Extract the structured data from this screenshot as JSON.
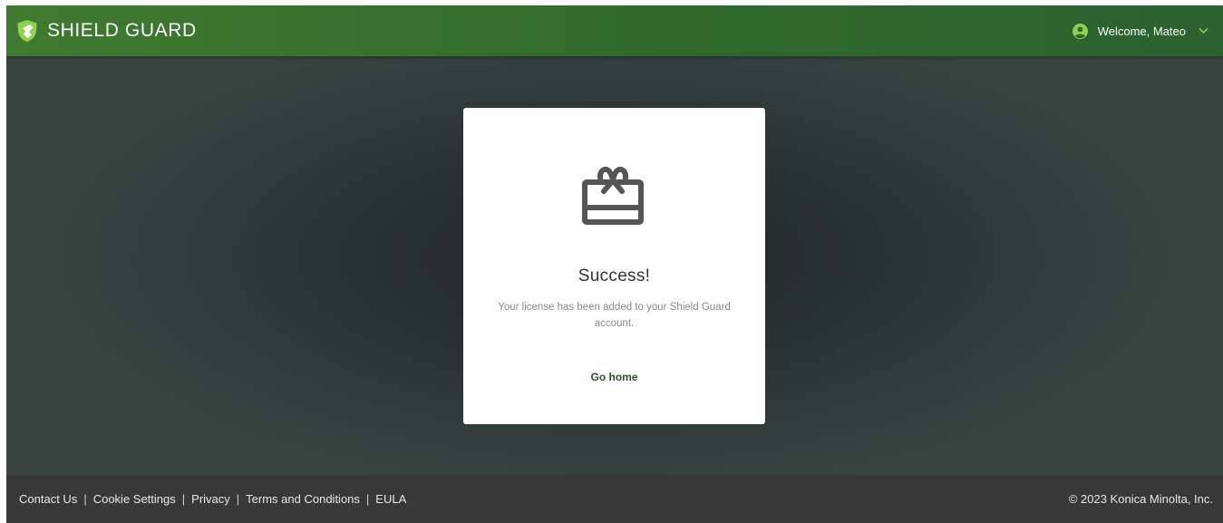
{
  "header": {
    "brand_name": "SHIELD GUARD",
    "brand_icon": "shield-logo-icon",
    "user_icon": "user-circle-icon",
    "welcome_text": "Welcome, Mateo",
    "menu_icon": "chevron-down-icon",
    "accent_color": "#8fd14f"
  },
  "dialog": {
    "icon": "gift-card-icon",
    "title": "Success!",
    "message": "Your license has been added to your Shield Guard account.",
    "action_label": "Go home"
  },
  "footer": {
    "links": [
      "Contact Us",
      "Cookie Settings",
      "Privacy",
      "Terms and Conditions",
      "EULA"
    ],
    "separator": "|",
    "copyright": "© 2023 Konica Minolta, Inc."
  }
}
